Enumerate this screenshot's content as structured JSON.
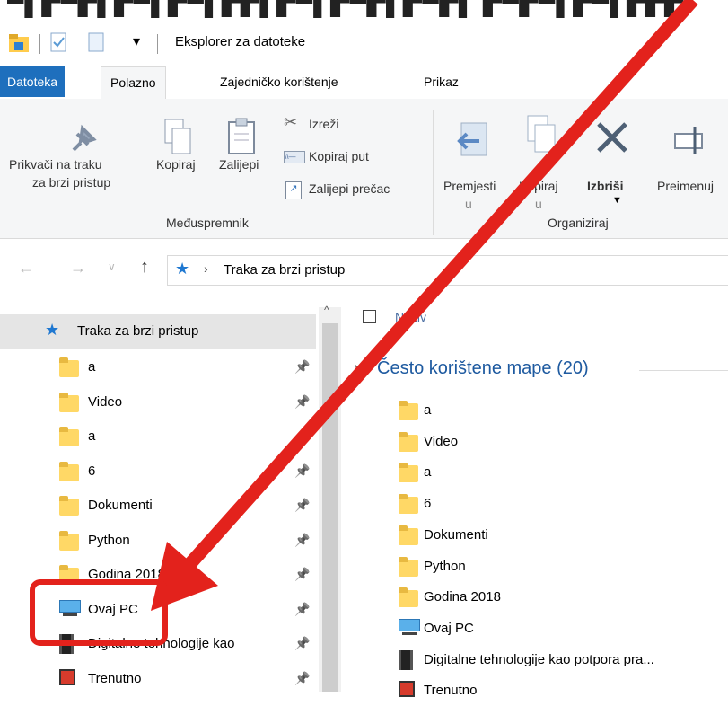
{
  "window": {
    "title": "Eksplorer za datoteke"
  },
  "tabs": [
    {
      "label": "Datoteka"
    },
    {
      "label": "Polazno"
    },
    {
      "label": "Zajedničko korištenje"
    },
    {
      "label": "Prikaz"
    }
  ],
  "ribbon": {
    "pin_label_1": "Prikvači na traku",
    "pin_label_2": "za brzi pristup",
    "copy_label": "Kopiraj",
    "paste_label": "Zalijepi",
    "cut_label": "Izreži",
    "copy_path_label": "Kopiraj put",
    "paste_shortcut_label": "Zalijepi prečac",
    "clipboard_group": "Međuspremnik",
    "move_to_label_1": "Premjesti",
    "move_to_label_2": "u",
    "copy_to_label_1": "Kopiraj",
    "copy_to_label_2": "u",
    "delete_label": "Izbriši",
    "rename_label": "Preimenuj",
    "organize_group": "Organiziraj"
  },
  "address": {
    "path": "Traka za brzi pristup"
  },
  "nav": {
    "header": "Traka za brzi pristup",
    "items": [
      {
        "label": "a",
        "icon": "folder-icon",
        "pinned": true
      },
      {
        "label": "Video",
        "icon": "folder-icon",
        "pinned": true
      },
      {
        "label": "a",
        "icon": "folder-icon",
        "pinned": false
      },
      {
        "label": "6",
        "icon": "folder-icon",
        "pinned": true
      },
      {
        "label": "Dokumenti",
        "icon": "folder-icon",
        "pinned": true
      },
      {
        "label": "Python",
        "icon": "folder-icon",
        "pinned": true
      },
      {
        "label": "Godina 2018",
        "icon": "folder-icon",
        "pinned": true
      },
      {
        "label": "Ovaj PC",
        "icon": "pc-icon",
        "pinned": true
      },
      {
        "label": "Digitalne tehnologije kao",
        "icon": "document-icon",
        "pinned": true
      },
      {
        "label": "Trenutno",
        "icon": "red-folder-icon",
        "pinned": true
      }
    ]
  },
  "content": {
    "column_name": "Naziv",
    "group_title": "Često korištene mape (20)",
    "items": [
      {
        "label": "a",
        "icon": "folder-icon"
      },
      {
        "label": "Video",
        "icon": "folder-icon"
      },
      {
        "label": "a",
        "icon": "folder-icon"
      },
      {
        "label": "6",
        "icon": "folder-icon"
      },
      {
        "label": "Dokumenti",
        "icon": "folder-icon"
      },
      {
        "label": "Python",
        "icon": "folder-icon"
      },
      {
        "label": "Godina 2018",
        "icon": "folder-icon"
      },
      {
        "label": "Ovaj PC",
        "icon": "pc-icon"
      },
      {
        "label": "Digitalne tehnologije kao potpora pra...",
        "icon": "document-icon"
      },
      {
        "label": "Trenutno",
        "icon": "red-folder-icon"
      }
    ]
  },
  "colors": {
    "accent": "#1e6fbd",
    "annotation_red": "#e3221c",
    "selection": "#e5e5e5",
    "link_blue": "#1e5aa0"
  }
}
